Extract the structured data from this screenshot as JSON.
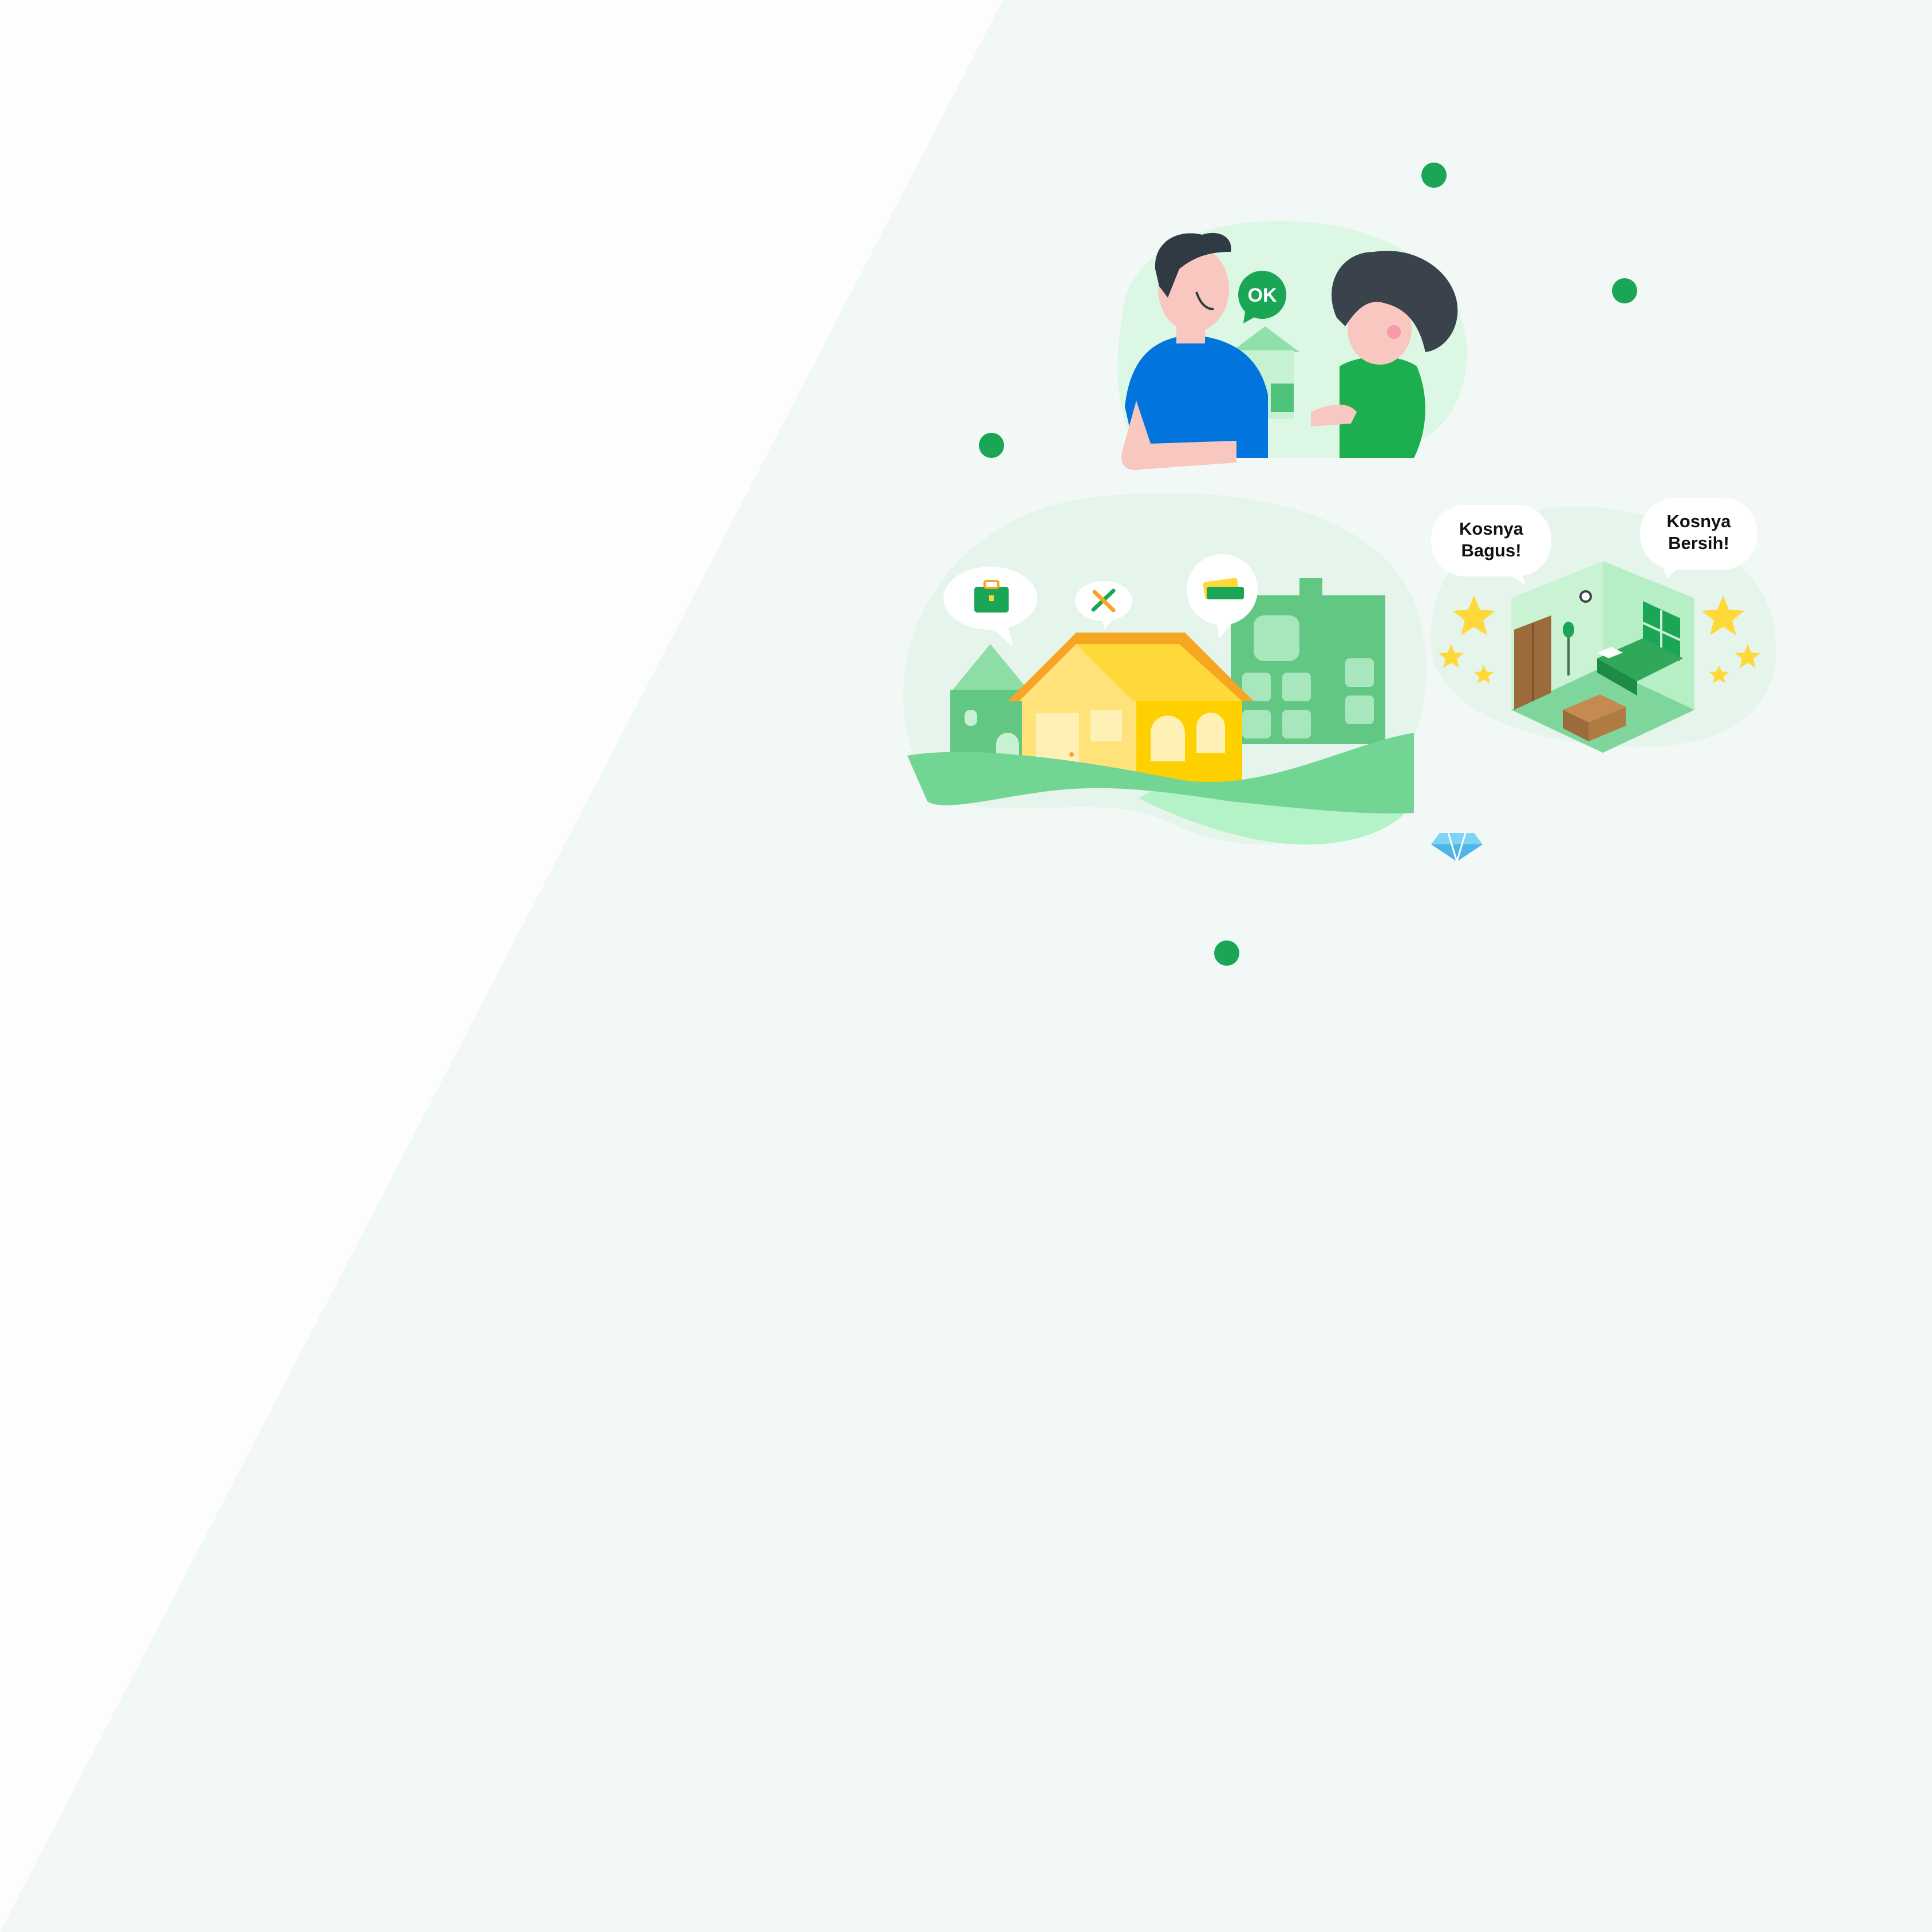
{
  "colors": {
    "background_left": "#fdfdfd",
    "background_right": "#f2f8f5",
    "accent_green": "#1aa655",
    "male_shirt": "#0274de",
    "female_dress": "#1dae50",
    "house_yellow": "#ffd83a",
    "building_green": "#63c784",
    "room_wall": "#c9f3d3"
  },
  "ok_badge": {
    "label": "OK"
  },
  "review_bubbles": [
    {
      "line1": "Kosnya",
      "line2": "Bagus!"
    },
    {
      "line1": "Kosnya",
      "line2": "Bersih!"
    }
  ],
  "icons": [
    "briefcase-icon",
    "tools-icon",
    "money-icon",
    "star-icon",
    "diamond-icon"
  ]
}
